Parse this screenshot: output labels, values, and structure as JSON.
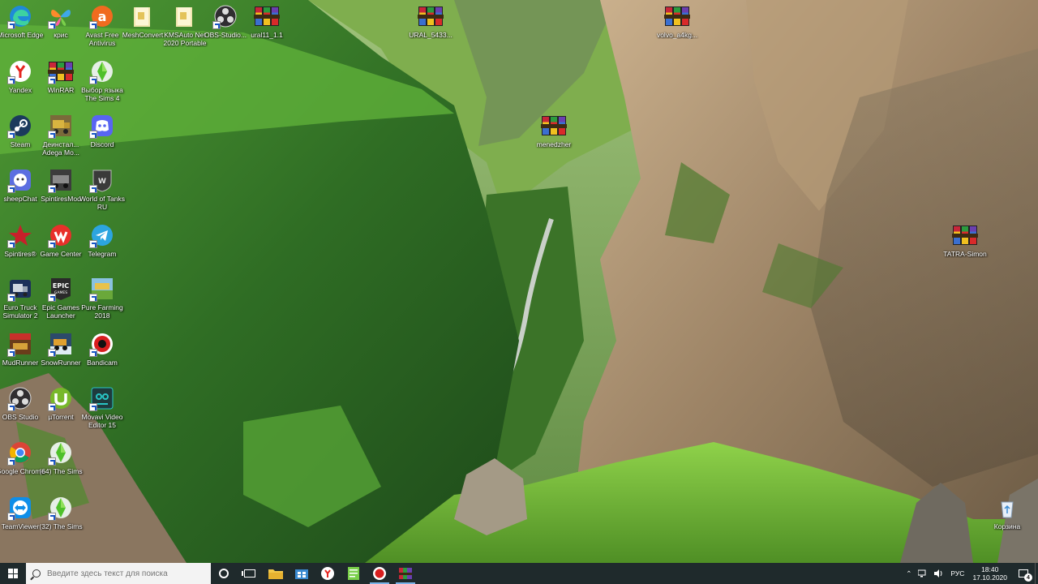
{
  "desktop": {
    "icons": [
      {
        "label": "Microsoft Edge",
        "icon": "edge-icon"
      },
      {
        "label": "крис",
        "icon": "butterfly-icon"
      },
      {
        "label": "Avast Free Antivirus",
        "icon": "avast-icon"
      },
      {
        "label": "MeshConvert",
        "icon": "folder-icon"
      },
      {
        "label": "KMSAuto Net 2020 Portable",
        "icon": "folder-icon"
      },
      {
        "label": "OBS-Studio...",
        "icon": "obs-icon"
      },
      {
        "label": "ural11_1.1",
        "icon": "winrar-archive-icon"
      },
      {
        "label": "URAL_5433...",
        "icon": "winrar-archive-icon"
      },
      {
        "label": "volvo_a4kg...",
        "icon": "winrar-archive-icon"
      },
      {
        "label": "Yandex",
        "icon": "yandex-icon"
      },
      {
        "label": "WinRAR",
        "icon": "winrar-icon"
      },
      {
        "label": "Выбор языка The Sims 4",
        "icon": "sims-icon"
      },
      {
        "label": "Steam",
        "icon": "steam-icon"
      },
      {
        "label": "Деинстал... Adega Mo...",
        "icon": "truck-icon"
      },
      {
        "label": "Discord",
        "icon": "discord-icon"
      },
      {
        "label": "menedzher",
        "icon": "winrar-archive-icon"
      },
      {
        "label": "sheepChat",
        "icon": "sheepchat-icon"
      },
      {
        "label": "SpintiresMod",
        "icon": "spintires-mod-icon"
      },
      {
        "label": "World of Tanks RU",
        "icon": "wot-icon"
      },
      {
        "label": "Spintires®",
        "icon": "spintires-icon"
      },
      {
        "label": "Game Center",
        "icon": "game-center-icon"
      },
      {
        "label": "Telegram",
        "icon": "telegram-icon"
      },
      {
        "label": "TATRA-Simon",
        "icon": "winrar-archive-icon"
      },
      {
        "label": "Euro Truck Simulator 2",
        "icon": "ets2-icon"
      },
      {
        "label": "Epic Games Launcher",
        "icon": "epic-icon"
      },
      {
        "label": "Pure Farming 2018",
        "icon": "pure-farming-icon"
      },
      {
        "label": "MudRunner",
        "icon": "mudrunner-icon"
      },
      {
        "label": "SnowRunner",
        "icon": "snowrunner-icon"
      },
      {
        "label": "Bandicam",
        "icon": "bandicam-icon"
      },
      {
        "label": "OBS Studio",
        "icon": "obs-icon"
      },
      {
        "label": "µTorrent",
        "icon": "utorrent-icon"
      },
      {
        "label": "Movavi Video Editor 15",
        "icon": "movavi-icon"
      },
      {
        "label": "Google Chrome",
        "icon": "chrome-icon"
      },
      {
        "label": "(64) The Sims",
        "icon": "sims-icon"
      },
      {
        "label": "TeamViewer",
        "icon": "teamviewer-icon"
      },
      {
        "label": "(32) The Sims",
        "icon": "sims-icon"
      },
      {
        "label": "Корзина",
        "icon": "recycle-bin-icon"
      }
    ]
  },
  "taskbar": {
    "search_placeholder": "Введите здесь текст для поиска",
    "pinned": [
      "file-explorer-icon",
      "store-icon",
      "yandex-browser-icon",
      "notepad-icon",
      "bandicam-icon",
      "winrar-icon"
    ],
    "tray": {
      "language": "РУС",
      "time": "18:40",
      "date": "17.10.2020",
      "notifications": "4"
    }
  },
  "colors": {
    "taskbar": "#1f2a2c",
    "search_box": "#f3f3f3",
    "accent": "#7ab3e8"
  }
}
